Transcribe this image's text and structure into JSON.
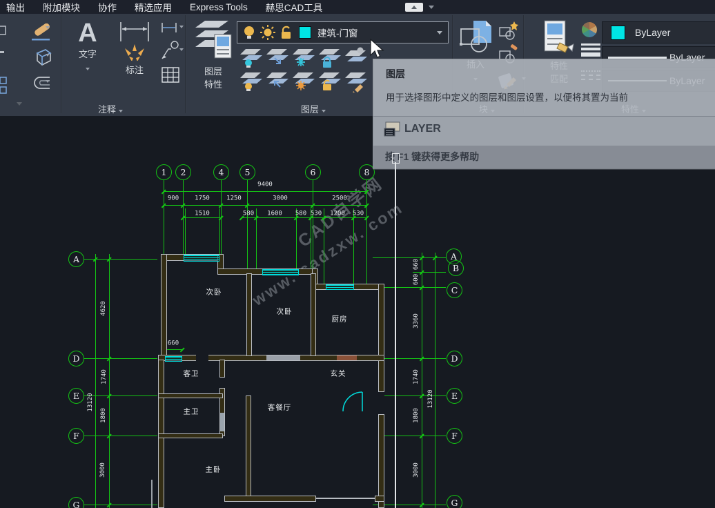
{
  "menu": {
    "items": [
      "输出",
      "附加模块",
      "协作",
      "精选应用",
      "Express Tools",
      "赫思CAD工具"
    ]
  },
  "ribbon": {
    "annotation": {
      "label": "注释",
      "big_a": "A",
      "text_button": "文字",
      "dim_button": "标注"
    },
    "layers": {
      "label": "图层",
      "props_line1": "图层",
      "props_line2": "特性",
      "current_layer": "建筑-门窗"
    },
    "block": {
      "label": "块",
      "insert_button": "插入"
    },
    "props": {
      "label": "特性",
      "match_line1": "特性",
      "match_line2": "匹配",
      "color_value": "ByLayer",
      "lineweight_value": "ByLayer",
      "linetype_value": "ByLayer"
    }
  },
  "tooltip": {
    "title": "图层",
    "desc": "用于选择图形中定义的图层和图层设置，以便将其置为当前",
    "command": "LAYER",
    "footer": "按 F1 键获得更多帮助"
  },
  "drawing": {
    "watermark1": "CAD自学网",
    "watermark2": "www. cadzxw. com",
    "grid_top": [
      "1",
      "2",
      "4",
      "5",
      "6",
      "8"
    ],
    "grid_left": [
      "A",
      "D",
      "E",
      "F",
      "G"
    ],
    "grid_right": [
      "A",
      "B",
      "C",
      "D",
      "E",
      "F",
      "G"
    ],
    "dims": {
      "overall_top": "9400",
      "top2": [
        "900",
        "1750",
        "1250",
        "3000",
        "2500"
      ],
      "top3": [
        "1510",
        "580",
        "1600",
        "580",
        "530",
        "1200",
        "530"
      ],
      "left": [
        "4620",
        "1740",
        "1800",
        "3000"
      ],
      "left_overall": "13120",
      "left_660": "660",
      "right": [
        "660",
        "600",
        "3360",
        "1740",
        "1800",
        "3000"
      ],
      "right_overall": "13120"
    },
    "rooms": [
      "次卧",
      "次卧",
      "厨房",
      "客卫",
      "玄关",
      "主卫",
      "客餐厅",
      "主卧"
    ]
  }
}
